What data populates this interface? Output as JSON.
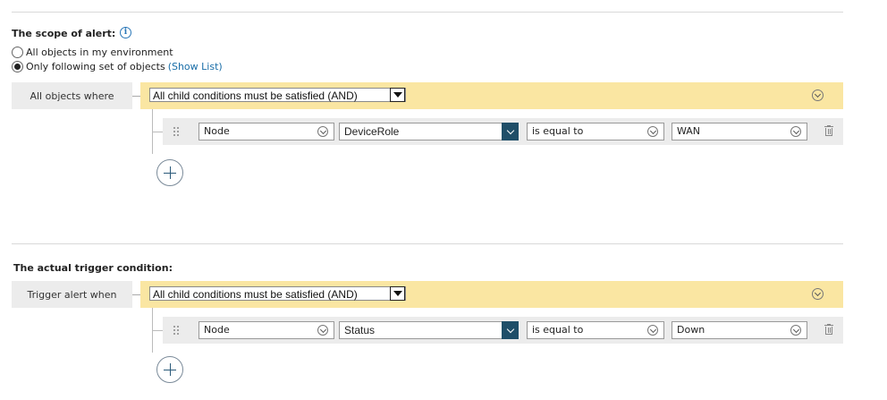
{
  "scope": {
    "title": "The scope of alert:",
    "info_icon": "info-icon",
    "options": [
      {
        "label": "All objects in my environment",
        "selected": false
      },
      {
        "label": "Only following set of objects",
        "selected": true
      }
    ],
    "show_list_link": "(Show List)",
    "left_label": "All objects where",
    "group_select_value": "All child conditions must be satisfied (AND)",
    "condition": {
      "entity": "Node",
      "property": "DeviceRole",
      "operator": "is equal to",
      "value": "WAN"
    }
  },
  "trigger": {
    "title": "The actual trigger condition:",
    "left_label": "Trigger alert when",
    "group_select_value": "All child conditions must be satisfied (AND)",
    "condition": {
      "entity": "Node",
      "property": "Status",
      "operator": "is equal to",
      "value": "Down"
    }
  },
  "colors": {
    "group_bar": "#fae6a2",
    "row_bar": "#ececec",
    "link": "#1a6ea8",
    "property_dropdown_button": "#1f4e68"
  }
}
